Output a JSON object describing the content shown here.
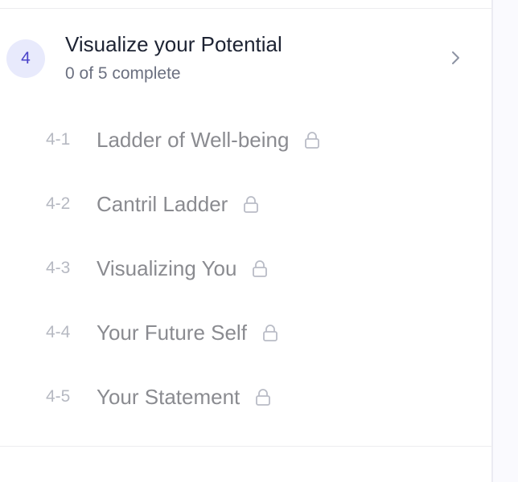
{
  "section": {
    "number": "4",
    "title": "Visualize your Potential",
    "progress": "0 of 5 complete"
  },
  "lessons": [
    {
      "number": "4-1",
      "title": "Ladder of Well-being",
      "icon": "lock-icon"
    },
    {
      "number": "4-2",
      "title": "Cantril Ladder",
      "icon": "lock-icon"
    },
    {
      "number": "4-3",
      "title": "Visualizing You",
      "icon": "lock-icon"
    },
    {
      "number": "4-4",
      "title": "Your Future Self",
      "icon": "lock-icon"
    },
    {
      "number": "4-5",
      "title": "Your Statement",
      "icon": "lock-icon"
    }
  ],
  "colors": {
    "badge_bg": "#e8eafc",
    "badge_text": "#4a43c9",
    "title_text": "#1d2333",
    "muted_text": "#8a8b90"
  }
}
